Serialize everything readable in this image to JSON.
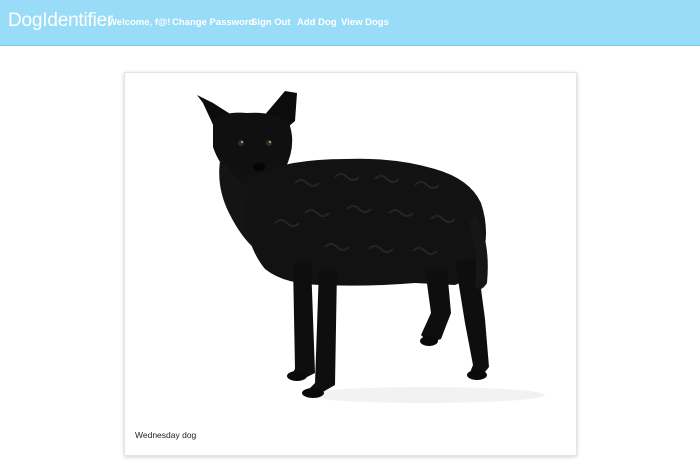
{
  "navbar": {
    "brand": "DogIdentifier",
    "links": [
      {
        "label": "Welcome, f@!"
      },
      {
        "label": "Change Password"
      },
      {
        "label": "Sign Out"
      },
      {
        "label": "Add Dog"
      },
      {
        "label": "View Dogs"
      }
    ],
    "background_color": "#99dcf7"
  },
  "dog_card": {
    "caption": "Wednesday dog",
    "image_subject": "black-dog-photo"
  }
}
